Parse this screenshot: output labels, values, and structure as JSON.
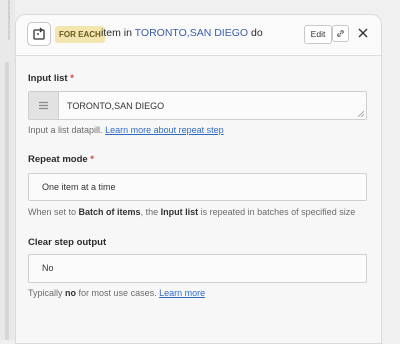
{
  "header": {
    "badge": "FOR EACH",
    "title_prefix": "item in",
    "datapill": "TORONTO,SAN DIEGO",
    "title_suffix": "do",
    "edit_label": "Edit"
  },
  "input_list": {
    "label": "Input list",
    "required_mark": "*",
    "value": "TORONTO,SAN DIEGO",
    "help_text": "Input a list datapill.",
    "help_link": "Learn more about repeat step"
  },
  "repeat_mode": {
    "label": "Repeat mode",
    "required_mark": "*",
    "value": "One item at a time",
    "help_pre": "When set to",
    "help_bold1": "Batch of items",
    "help_mid": ", the",
    "help_bold2": "Input list",
    "help_post": "is repeated in batches of specified size"
  },
  "clear_output": {
    "label": "Clear step output",
    "value": "No",
    "help_pre": "Typically",
    "help_bold": "no",
    "help_post": "for most use cases.",
    "help_link": "Learn more"
  },
  "colors": {
    "badge_bg": "#f2e5b0",
    "link": "#2e6bc7",
    "datapill_text": "#3a5ea8",
    "required": "#d04437"
  },
  "icons": [
    "repeat-step-icon",
    "link-icon",
    "close-icon",
    "datapill-handle-icon",
    "resize-handle-icon"
  ]
}
